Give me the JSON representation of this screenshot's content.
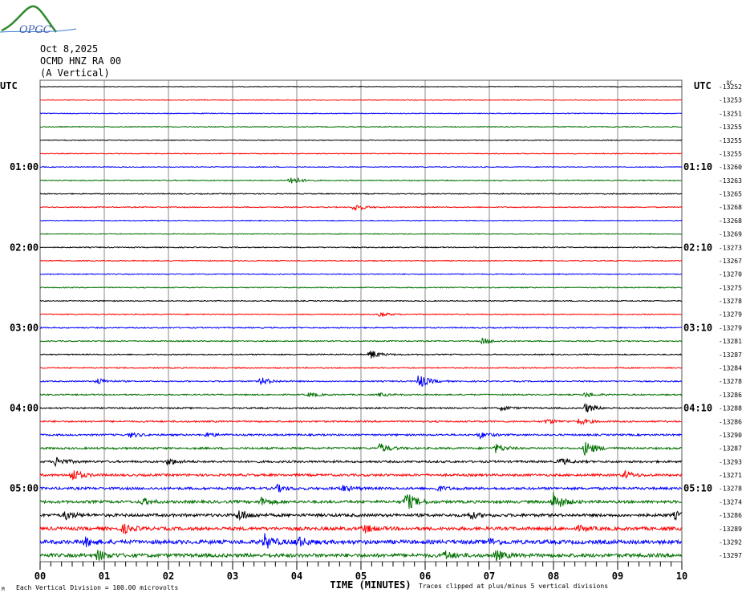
{
  "header": {
    "logo_text": "OPGC",
    "date": "Oct 8,2025",
    "station": "OCMD HNZ RA 00",
    "component": "(A Vertical)"
  },
  "chart_data": {
    "type": "line",
    "title": "OCMD HNZ RA 00 helicorder",
    "xlabel": "TIME (MINUTES)",
    "x_ticks": [
      "00",
      "01",
      "02",
      "03",
      "04",
      "05",
      "06",
      "07",
      "08",
      "09",
      "10"
    ],
    "xlim": [
      0,
      10
    ],
    "left_axis_title": "UTC",
    "right_axis_title": "UTC",
    "dc_label": "DC",
    "left_labels": [
      {
        "row": 6,
        "text": "01:00"
      },
      {
        "row": 12,
        "text": "02:00"
      },
      {
        "row": 18,
        "text": "03:00"
      },
      {
        "row": 24,
        "text": "04:00"
      },
      {
        "row": 30,
        "text": "05:00"
      }
    ],
    "right_labels": [
      {
        "row": 6,
        "text": "01:10"
      },
      {
        "row": 12,
        "text": "02:10"
      },
      {
        "row": 18,
        "text": "03:10"
      },
      {
        "row": 24,
        "text": "04:10"
      },
      {
        "row": 30,
        "text": "05:10"
      }
    ],
    "dc_offsets": [
      "-13252",
      "-13253",
      "-13251",
      "-13255",
      "-13255",
      "-13255",
      "-13260",
      "-13263",
      "-13265",
      "-13268",
      "-13268",
      "-13269",
      "-13273",
      "-13267",
      "-13270",
      "-13275",
      "-13278",
      "-13279",
      "-13279",
      "-13281",
      "-13287",
      "-13284",
      "-13278",
      "-13286",
      "-13288",
      "-13286",
      "-13290",
      "-13287",
      "-13293",
      "-13271",
      "-13278",
      "-13274",
      "-13286",
      "-13289",
      "-13292",
      "-13297"
    ],
    "trace_colors": [
      "#000000",
      "#ff0000",
      "#0000ff",
      "#007000"
    ],
    "noise_levels": [
      0.4,
      0.5,
      0.5,
      0.5,
      0.5,
      0.5,
      0.5,
      0.6,
      0.6,
      0.6,
      0.5,
      0.5,
      0.6,
      0.6,
      0.6,
      0.6,
      0.6,
      0.6,
      0.7,
      0.7,
      0.7,
      0.7,
      0.8,
      0.8,
      0.9,
      1.0,
      1.1,
      1.2,
      1.3,
      1.4,
      1.5,
      1.7,
      1.8,
      2.0,
      2.4,
      2.2
    ],
    "events": [
      {
        "row": 7,
        "minute": 3.9,
        "amp": 6
      },
      {
        "row": 9,
        "minute": 4.9,
        "amp": 5
      },
      {
        "row": 17,
        "minute": 5.3,
        "amp": 3
      },
      {
        "row": 19,
        "minute": 6.9,
        "amp": 4
      },
      {
        "row": 20,
        "minute": 5.15,
        "amp": 6
      },
      {
        "row": 22,
        "minute": 0.9,
        "amp": 4
      },
      {
        "row": 22,
        "minute": 3.45,
        "amp": 5
      },
      {
        "row": 22,
        "minute": 5.9,
        "amp": 10
      },
      {
        "row": 23,
        "minute": 4.2,
        "amp": 3
      },
      {
        "row": 23,
        "minute": 5.3,
        "amp": 2
      },
      {
        "row": 23,
        "minute": 8.5,
        "amp": 3
      },
      {
        "row": 24,
        "minute": 7.2,
        "amp": 3
      },
      {
        "row": 24,
        "minute": 8.5,
        "amp": 6
      },
      {
        "row": 25,
        "minute": 7.9,
        "amp": 3
      },
      {
        "row": 25,
        "minute": 8.4,
        "amp": 4
      },
      {
        "row": 26,
        "minute": 1.4,
        "amp": 3
      },
      {
        "row": 26,
        "minute": 2.6,
        "amp": 3
      },
      {
        "row": 26,
        "minute": 6.85,
        "amp": 4
      },
      {
        "row": 27,
        "minute": 5.3,
        "amp": 6
      },
      {
        "row": 27,
        "minute": 7.1,
        "amp": 5
      },
      {
        "row": 27,
        "minute": 8.5,
        "amp": 10
      },
      {
        "row": 28,
        "minute": 0.25,
        "amp": 6
      },
      {
        "row": 28,
        "minute": 2.0,
        "amp": 4
      },
      {
        "row": 28,
        "minute": 8.1,
        "amp": 4
      },
      {
        "row": 29,
        "minute": 0.5,
        "amp": 8
      },
      {
        "row": 29,
        "minute": 9.1,
        "amp": 5
      },
      {
        "row": 30,
        "minute": 3.7,
        "amp": 4
      },
      {
        "row": 30,
        "minute": 4.7,
        "amp": 4
      },
      {
        "row": 30,
        "minute": 6.2,
        "amp": 3
      },
      {
        "row": 31,
        "minute": 1.6,
        "amp": 4
      },
      {
        "row": 31,
        "minute": 3.45,
        "amp": 5
      },
      {
        "row": 31,
        "minute": 5.7,
        "amp": 12
      },
      {
        "row": 31,
        "minute": 8.0,
        "amp": 12
      },
      {
        "row": 32,
        "minute": 0.4,
        "amp": 5
      },
      {
        "row": 32,
        "minute": 3.1,
        "amp": 7
      },
      {
        "row": 32,
        "minute": 6.7,
        "amp": 4
      },
      {
        "row": 32,
        "minute": 9.9,
        "amp": 4
      },
      {
        "row": 33,
        "minute": 1.3,
        "amp": 5
      },
      {
        "row": 33,
        "minute": 5.05,
        "amp": 5
      },
      {
        "row": 33,
        "minute": 8.4,
        "amp": 3
      },
      {
        "row": 34,
        "minute": 0.7,
        "amp": 5
      },
      {
        "row": 34,
        "minute": 3.5,
        "amp": 9
      },
      {
        "row": 34,
        "minute": 4.0,
        "amp": 7
      },
      {
        "row": 34,
        "minute": 7.0,
        "amp": 4
      },
      {
        "row": 35,
        "minute": 0.9,
        "amp": 6
      },
      {
        "row": 35,
        "minute": 6.3,
        "amp": 5
      },
      {
        "row": 35,
        "minute": 7.1,
        "amp": 6
      }
    ]
  },
  "footer": {
    "scale_note": "Each Vertical Division =  100.00 microvolts",
    "clip_note": "Traces clipped at plus/minus 5 vertical divisions",
    "corner_mark": "M"
  }
}
